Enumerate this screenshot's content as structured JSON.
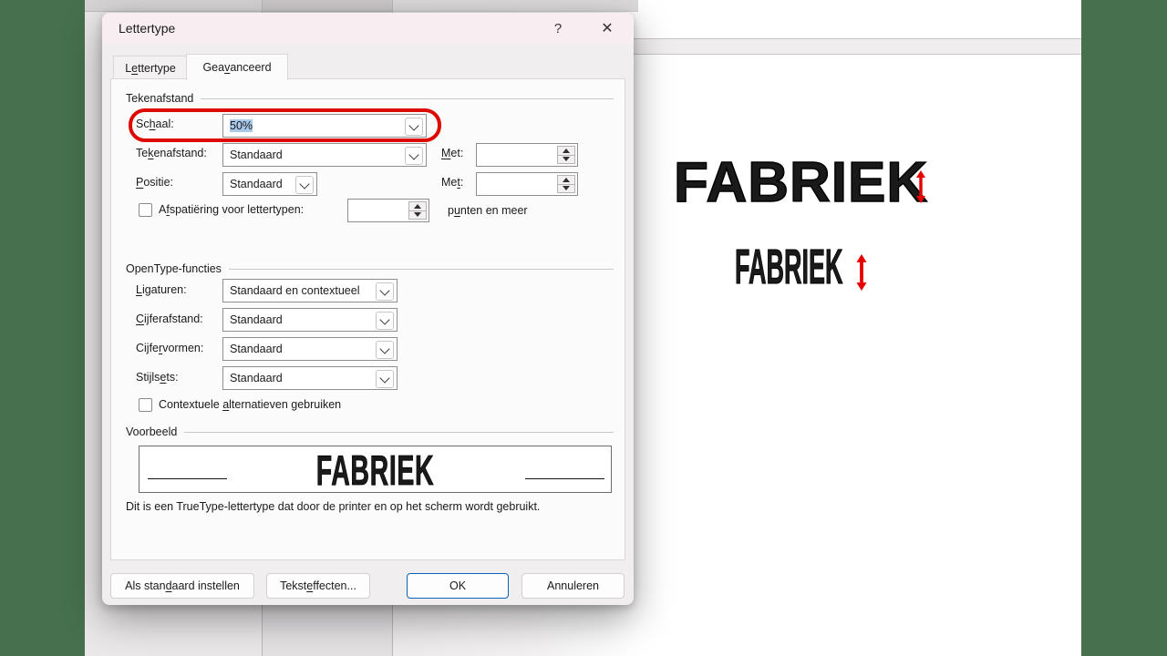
{
  "colors": {
    "desktop_green": "#47704e",
    "highlight_red": "#dc0a00",
    "selection_blue": "#a9c9ea",
    "arrow_red": "#e60000",
    "ok_border_blue": "#0b62b8"
  },
  "dialog": {
    "title": "Lettertype",
    "help_glyph": "?",
    "close_glyph": "✕",
    "tabs": {
      "lettertype": "Lettertype",
      "geavanceerd": "Geavanceerd"
    },
    "tekenafstand": {
      "title": "Tekenafstand",
      "schaal_label": "Schaal:",
      "schaal_value": "50%",
      "tekenafstand_label": "Tekenafstand:",
      "tekenafstand_value": "Standaard",
      "met1_label": "Met:",
      "met1_value": "",
      "positie_label": "Positie:",
      "positie_value": "Standaard",
      "met2_label": "Met:",
      "met2_value": "",
      "kerning_label": "Afspatiëring voor lettertypen:",
      "kerning_value": "",
      "kerning_suffix": "punten en meer"
    },
    "opentype": {
      "title": "OpenType-functies",
      "ligaturen_label": "Ligaturen:",
      "ligaturen_value": "Standaard en contextueel",
      "cijferafstand_label": "Cijferafstand:",
      "cijferafstand_value": "Standaard",
      "cijfervormen_label": "Cijfervormen:",
      "cijfervormen_value": "Standaard",
      "stijlsets_label": "Stijlsets:",
      "stijlsets_value": "Standaard",
      "contextual_label": "Contextuele alternatieven gebruiken"
    },
    "voorbeeld": {
      "title": "Voorbeeld",
      "preview_text": "FABRIEK",
      "description": "Dit is een TrueType-lettertype dat door de printer en op het scherm wordt gebruikt."
    },
    "buttons": {
      "set_default": "Als standaard instellen",
      "text_effects": "Teksteffecten...",
      "ok": "OK",
      "cancel": "Annuleren"
    }
  },
  "document": {
    "sample_large": "FABRIEK",
    "sample_small": "FABRIEK"
  }
}
